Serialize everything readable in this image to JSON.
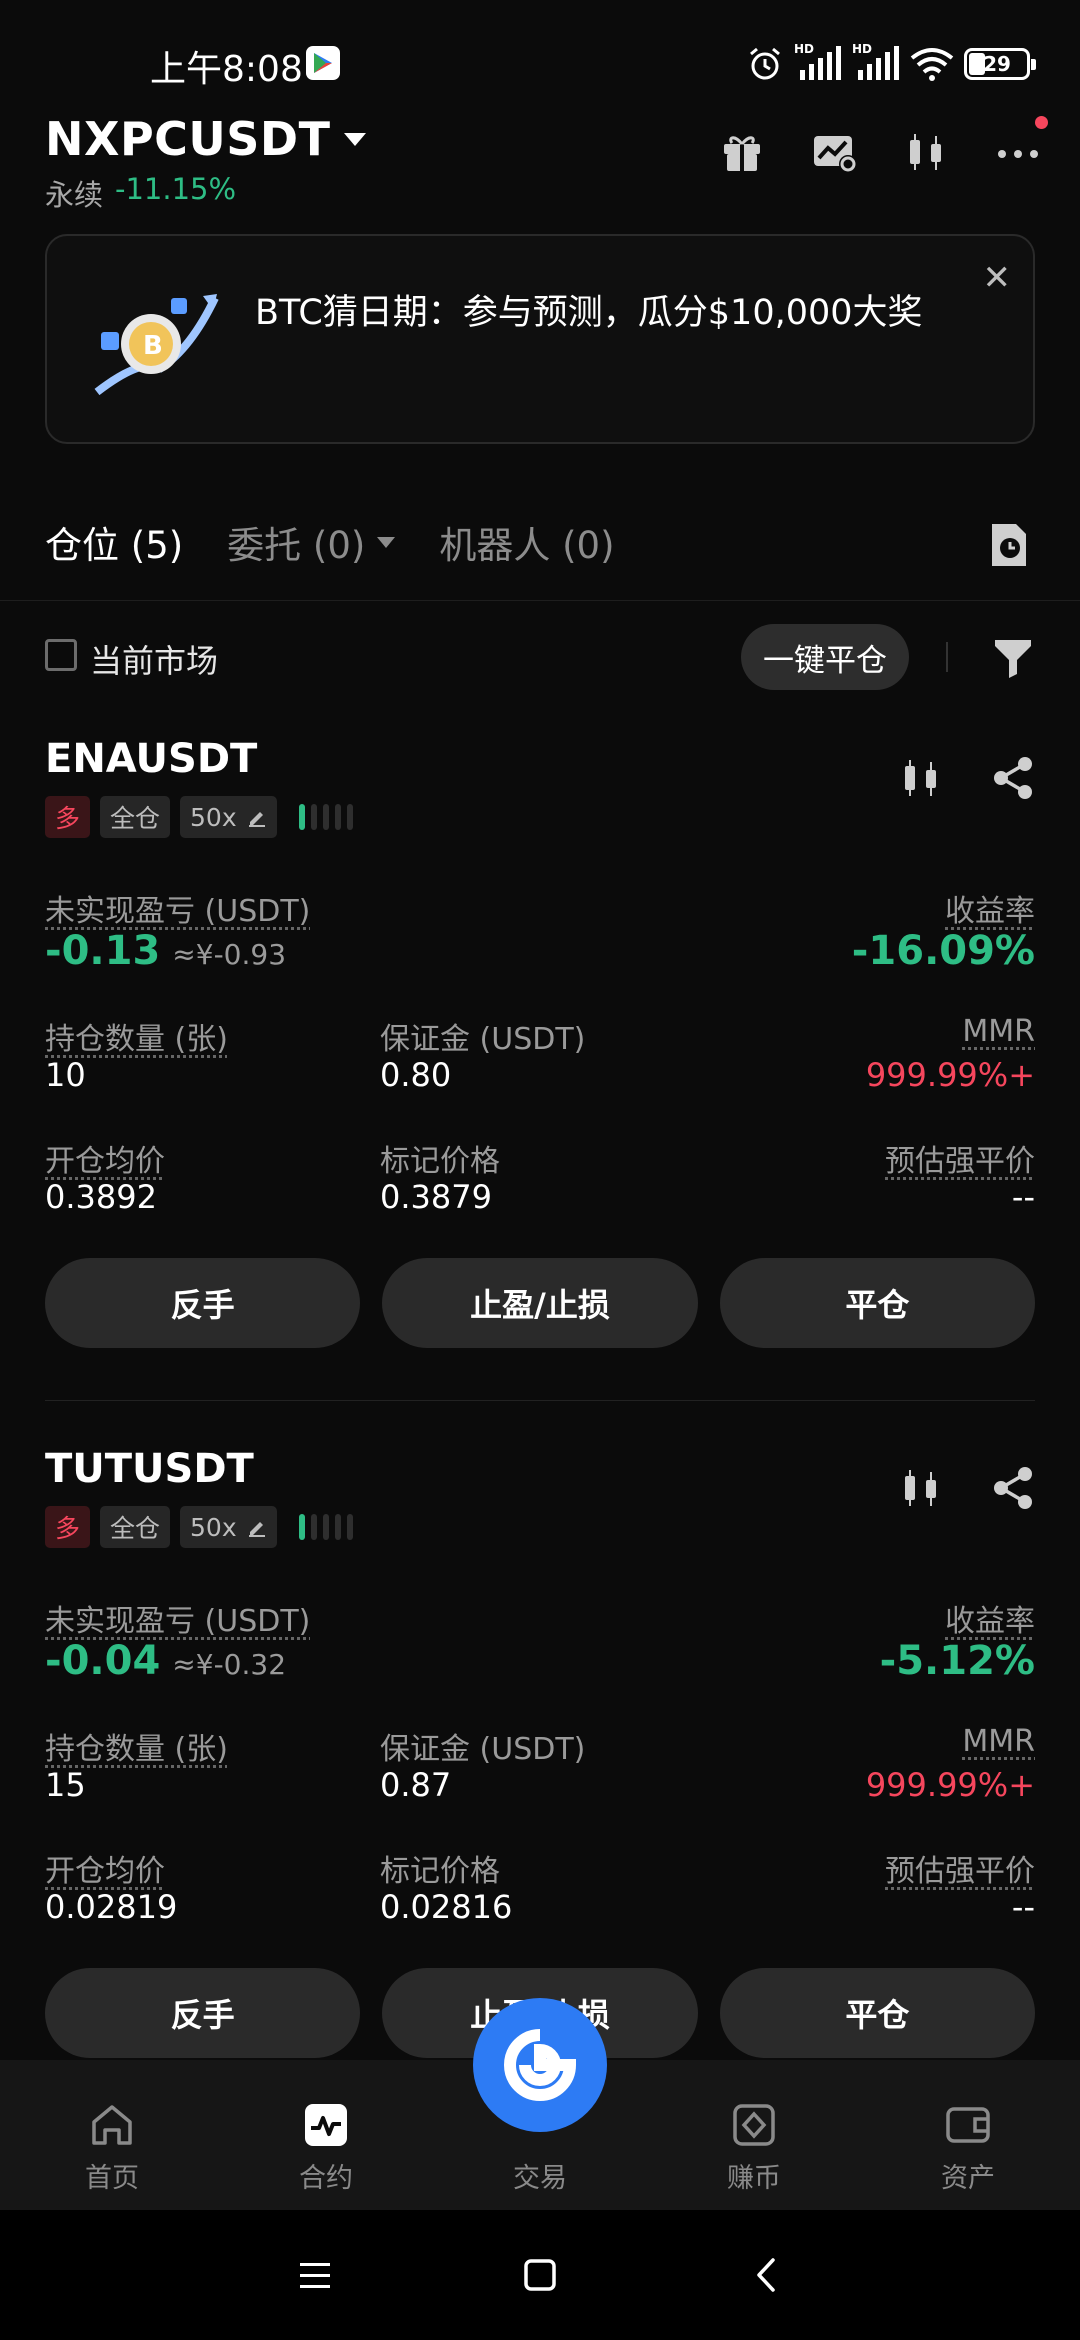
{
  "status_bar": {
    "time": "上午8:08",
    "network_1": "HD",
    "network_2": "HD",
    "battery": "29"
  },
  "header": {
    "pair": "NXPCUSDT",
    "type": "永续",
    "change": "-11.15%"
  },
  "banner": {
    "text": "BTC猜日期：参与预测，瓜分$10,000大奖",
    "close": "✕"
  },
  "tabs": [
    {
      "label": "仓位 (5)"
    },
    {
      "label": "委托 (0)"
    },
    {
      "label": "机器人 (0)"
    }
  ],
  "filter": {
    "current_market": "当前市场",
    "close_all": "一键平仓"
  },
  "labels": {
    "unrealized_pnl": "未实现盈亏 (USDT)",
    "roi": "收益率",
    "size": "持仓数量 (张)",
    "margin": "保证金 (USDT)",
    "mmr": "MMR",
    "entry_price": "开仓均价",
    "mark_price": "标记价格",
    "liq_price": "预估强平价"
  },
  "positions": [
    {
      "symbol": "ENAUSDT",
      "side": "多",
      "margin_mode": "全仓",
      "leverage": "50x",
      "pnl": "-0.13",
      "pnl_cny": "≈¥-0.93",
      "roi": "-16.09%",
      "size": "10",
      "margin": "0.80",
      "mmr": "999.99%+",
      "entry_price": "0.3892",
      "mark_price": "0.3879",
      "liq_price": "--",
      "actions": {
        "reverse": "反手",
        "tpsl": "止盈/止损",
        "close": "平仓"
      }
    },
    {
      "symbol": "TUTUSDT",
      "side": "多",
      "margin_mode": "全仓",
      "leverage": "50x",
      "pnl": "-0.04",
      "pnl_cny": "≈¥-0.32",
      "roi": "-5.12%",
      "size": "15",
      "margin": "0.87",
      "mmr": "999.99%+",
      "entry_price": "0.02819",
      "mark_price": "0.02816",
      "liq_price": "--",
      "actions": {
        "reverse": "反手",
        "tpsl": "止盈/止损",
        "close": "平仓"
      }
    }
  ],
  "bottom_nav": {
    "home": "首页",
    "futures": "合约",
    "trade": "交易",
    "earn": "赚币",
    "assets": "资产"
  },
  "colors": {
    "green": "#2ebd85",
    "red": "#f6465d",
    "accent_blue": "#2d7bf4"
  },
  "icons": [
    "gift-icon",
    "chart-settings-icon",
    "candlestick-icon",
    "more-icon",
    "history-icon",
    "funnel-icon",
    "share-icon",
    "edit-icon"
  ]
}
